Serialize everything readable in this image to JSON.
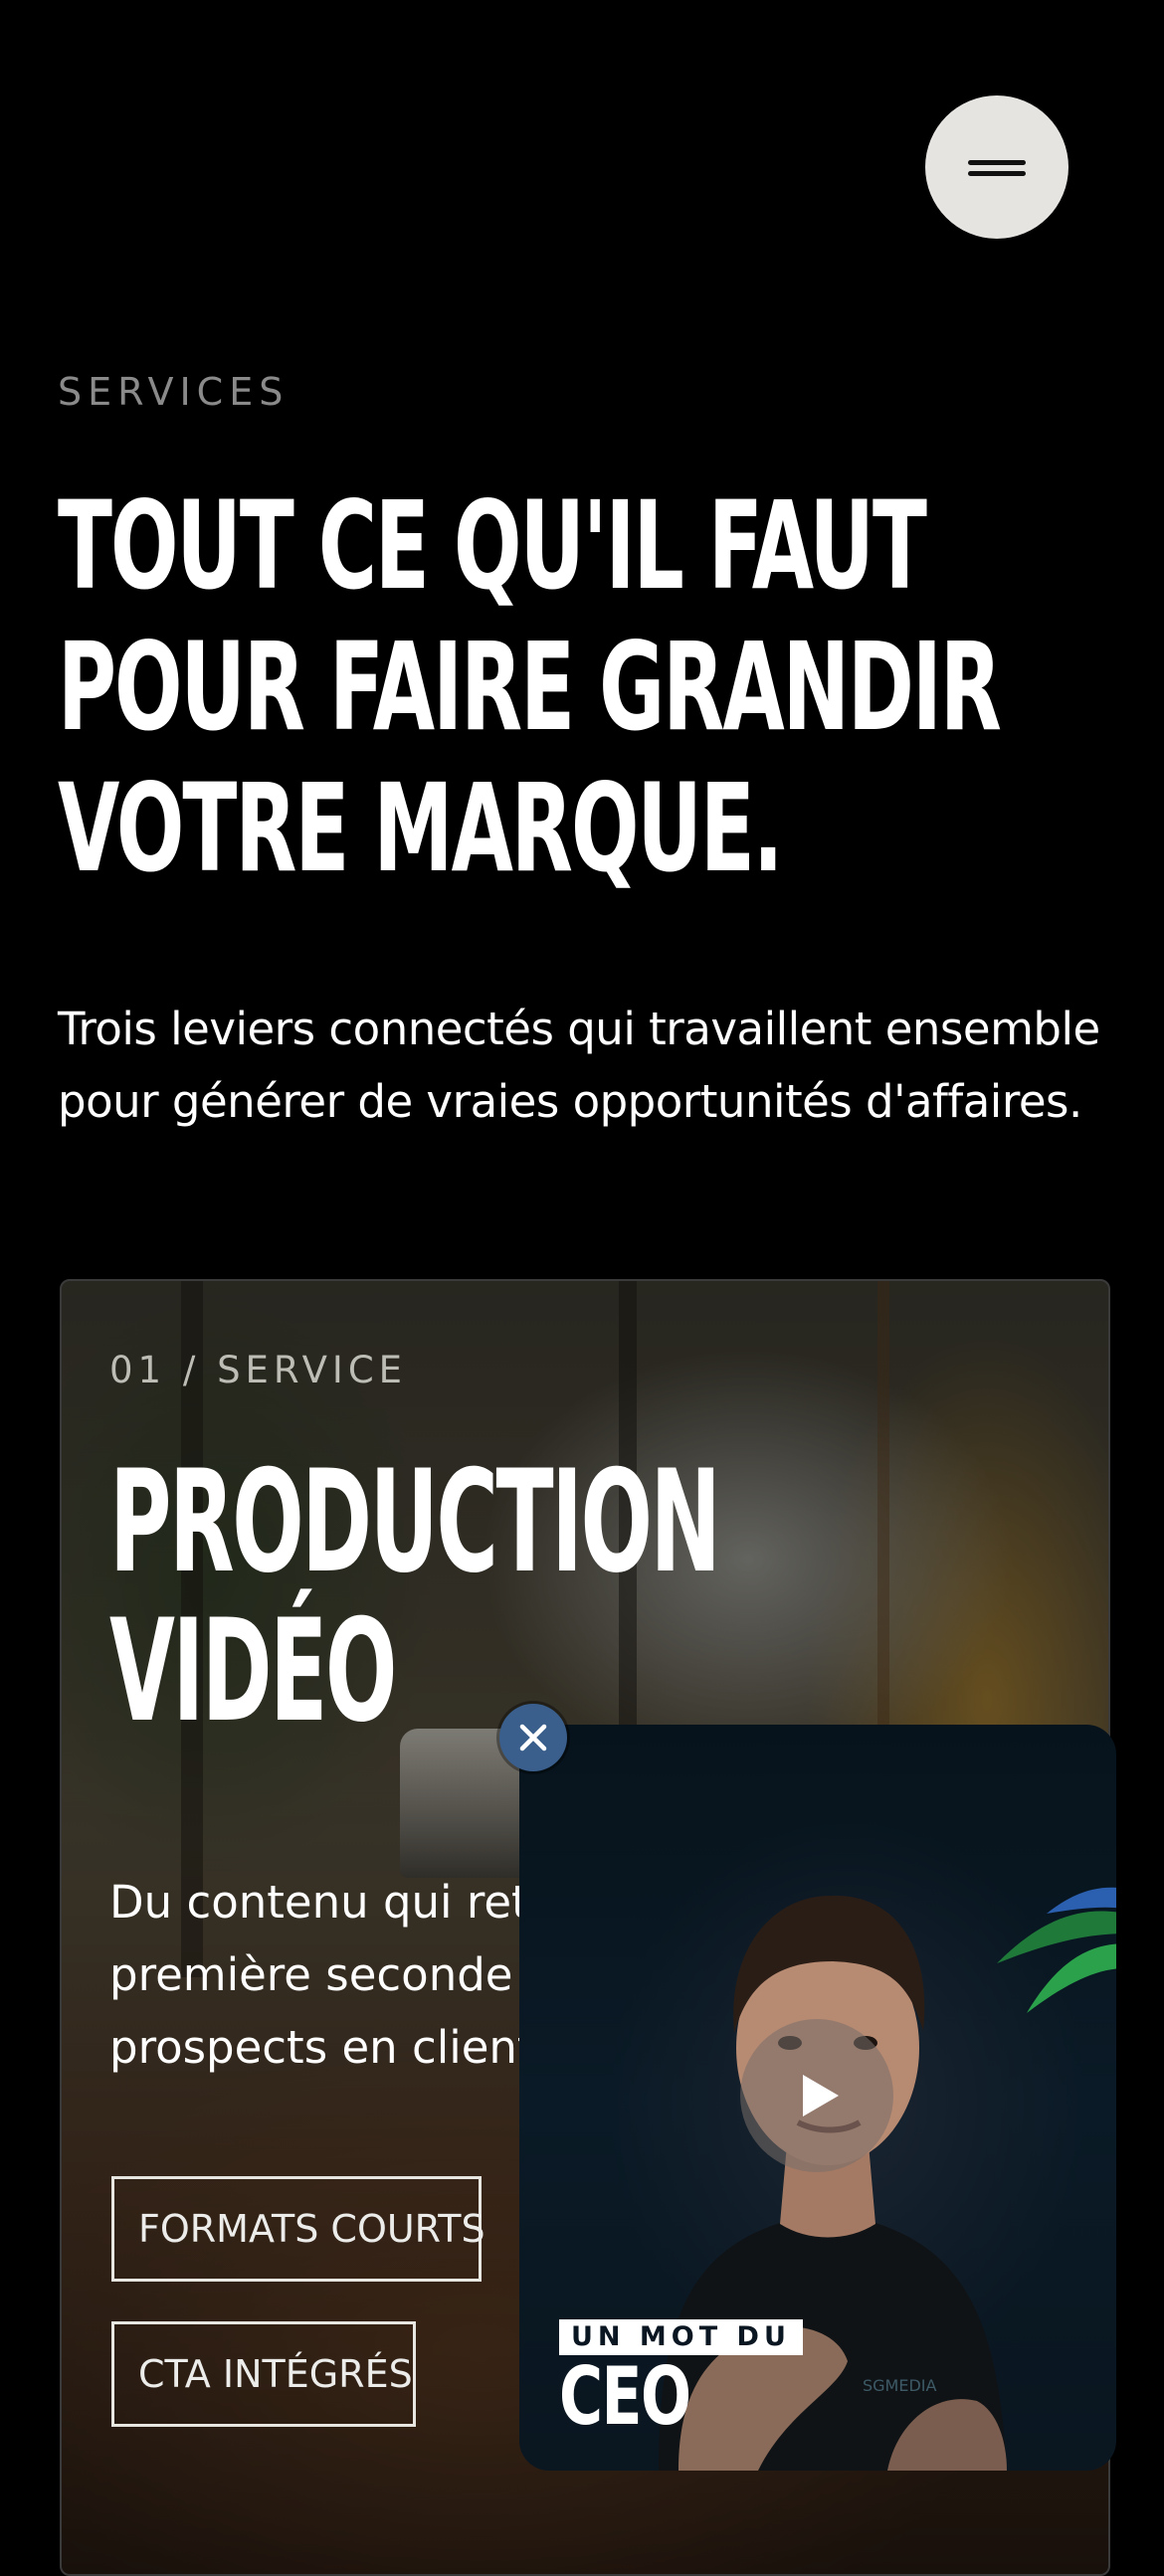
{
  "header": {
    "menu_icon": "hamburger-menu-icon"
  },
  "section": {
    "eyebrow": "SERVICES",
    "headline_lines": [
      "TOUT CE QU'IL FAUT",
      "POUR FAIRE GRANDIR",
      "VOTRE MARQUE."
    ],
    "intro_lines": [
      "Trois leviers connectés qui travaillent ensemble",
      "pour générer de vraies opportunités d'affaires."
    ]
  },
  "service_card": {
    "eyebrow": "01 / SERVICE",
    "title_lines": [
      "PRODUCTION",
      "VIDÉO"
    ],
    "description_lines": [
      "Du contenu qui reti",
      "première seconde e",
      "prospects en clients"
    ],
    "tags": [
      "FORMATS COURTS",
      "CTA INTÉGRÉS"
    ]
  },
  "video_widget": {
    "badge_pre": "UN MOT DU",
    "badge_main": "CEO",
    "shirt_logo": "SGMEDIA",
    "play_icon": "play-icon",
    "close_icon": "close-icon"
  },
  "colors": {
    "background": "#000000",
    "menu_button": "#e6e4e1",
    "close_button": "#3a5f8c",
    "widget_background": "#0a1a26"
  }
}
